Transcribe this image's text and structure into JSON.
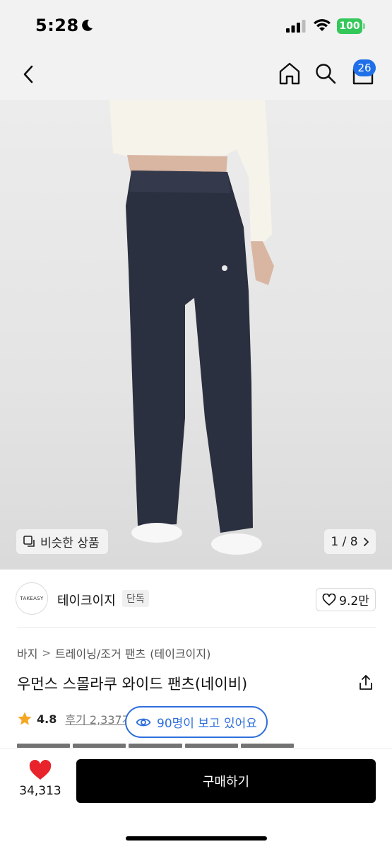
{
  "status_bar": {
    "time": "5:28",
    "battery": "100"
  },
  "nav": {
    "cart_count": "26"
  },
  "gallery": {
    "similar_label": "비슷한 상품",
    "counter": "1 / 8"
  },
  "brand": {
    "logo_text": "TAKEASY",
    "name": "테이크이지",
    "tag": "단독",
    "likes": "9.2만"
  },
  "breadcrumb": {
    "items": [
      "바지",
      "트레이닝/조거 팬츠",
      "(테이크이지)"
    ]
  },
  "product": {
    "title": "우먼스 스몰라쿠 와이드 팬츠(네이비)"
  },
  "rating": {
    "value": "4.8",
    "reviews": "후기 2,337개"
  },
  "viewers": {
    "text": "90명이 보고 있어요"
  },
  "bottom": {
    "wish_count": "34,313",
    "buy_label": "구매하기"
  },
  "colors": {
    "accent_blue": "#2f6fdc",
    "badge_blue": "#1f6fe8",
    "battery_green": "#34c759",
    "heart_red": "#e8232b",
    "star_orange": "#f5a623",
    "pants_navy": "#2b3040"
  },
  "icons": [
    "moon-icon",
    "signal-icon",
    "wifi-icon",
    "battery-icon",
    "back-icon",
    "home-icon",
    "search-icon",
    "cart-icon",
    "similar-icon",
    "chevron-right-icon",
    "heart-outline-icon",
    "share-icon",
    "star-icon",
    "eye-icon",
    "heart-filled-icon"
  ]
}
